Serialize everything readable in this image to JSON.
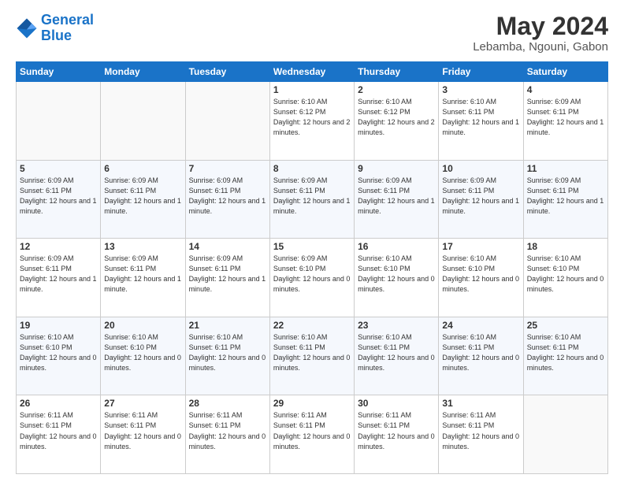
{
  "logo": {
    "line1": "General",
    "line2": "Blue"
  },
  "title": "May 2024",
  "location": "Lebamba, Ngouni, Gabon",
  "days_of_week": [
    "Sunday",
    "Monday",
    "Tuesday",
    "Wednesday",
    "Thursday",
    "Friday",
    "Saturday"
  ],
  "weeks": [
    [
      {
        "day": "",
        "info": ""
      },
      {
        "day": "",
        "info": ""
      },
      {
        "day": "",
        "info": ""
      },
      {
        "day": "1",
        "info": "Sunrise: 6:10 AM\nSunset: 6:12 PM\nDaylight: 12 hours\nand 2 minutes."
      },
      {
        "day": "2",
        "info": "Sunrise: 6:10 AM\nSunset: 6:12 PM\nDaylight: 12 hours\nand 2 minutes."
      },
      {
        "day": "3",
        "info": "Sunrise: 6:10 AM\nSunset: 6:11 PM\nDaylight: 12 hours\nand 1 minute."
      },
      {
        "day": "4",
        "info": "Sunrise: 6:09 AM\nSunset: 6:11 PM\nDaylight: 12 hours\nand 1 minute."
      }
    ],
    [
      {
        "day": "5",
        "info": "Sunrise: 6:09 AM\nSunset: 6:11 PM\nDaylight: 12 hours\nand 1 minute."
      },
      {
        "day": "6",
        "info": "Sunrise: 6:09 AM\nSunset: 6:11 PM\nDaylight: 12 hours\nand 1 minute."
      },
      {
        "day": "7",
        "info": "Sunrise: 6:09 AM\nSunset: 6:11 PM\nDaylight: 12 hours\nand 1 minute."
      },
      {
        "day": "8",
        "info": "Sunrise: 6:09 AM\nSunset: 6:11 PM\nDaylight: 12 hours\nand 1 minute."
      },
      {
        "day": "9",
        "info": "Sunrise: 6:09 AM\nSunset: 6:11 PM\nDaylight: 12 hours\nand 1 minute."
      },
      {
        "day": "10",
        "info": "Sunrise: 6:09 AM\nSunset: 6:11 PM\nDaylight: 12 hours\nand 1 minute."
      },
      {
        "day": "11",
        "info": "Sunrise: 6:09 AM\nSunset: 6:11 PM\nDaylight: 12 hours\nand 1 minute."
      }
    ],
    [
      {
        "day": "12",
        "info": "Sunrise: 6:09 AM\nSunset: 6:11 PM\nDaylight: 12 hours\nand 1 minute."
      },
      {
        "day": "13",
        "info": "Sunrise: 6:09 AM\nSunset: 6:11 PM\nDaylight: 12 hours\nand 1 minute."
      },
      {
        "day": "14",
        "info": "Sunrise: 6:09 AM\nSunset: 6:11 PM\nDaylight: 12 hours\nand 1 minute."
      },
      {
        "day": "15",
        "info": "Sunrise: 6:09 AM\nSunset: 6:10 PM\nDaylight: 12 hours\nand 0 minutes."
      },
      {
        "day": "16",
        "info": "Sunrise: 6:10 AM\nSunset: 6:10 PM\nDaylight: 12 hours\nand 0 minutes."
      },
      {
        "day": "17",
        "info": "Sunrise: 6:10 AM\nSunset: 6:10 PM\nDaylight: 12 hours\nand 0 minutes."
      },
      {
        "day": "18",
        "info": "Sunrise: 6:10 AM\nSunset: 6:10 PM\nDaylight: 12 hours\nand 0 minutes."
      }
    ],
    [
      {
        "day": "19",
        "info": "Sunrise: 6:10 AM\nSunset: 6:10 PM\nDaylight: 12 hours\nand 0 minutes."
      },
      {
        "day": "20",
        "info": "Sunrise: 6:10 AM\nSunset: 6:10 PM\nDaylight: 12 hours\nand 0 minutes."
      },
      {
        "day": "21",
        "info": "Sunrise: 6:10 AM\nSunset: 6:11 PM\nDaylight: 12 hours\nand 0 minutes."
      },
      {
        "day": "22",
        "info": "Sunrise: 6:10 AM\nSunset: 6:11 PM\nDaylight: 12 hours\nand 0 minutes."
      },
      {
        "day": "23",
        "info": "Sunrise: 6:10 AM\nSunset: 6:11 PM\nDaylight: 12 hours\nand 0 minutes."
      },
      {
        "day": "24",
        "info": "Sunrise: 6:10 AM\nSunset: 6:11 PM\nDaylight: 12 hours\nand 0 minutes."
      },
      {
        "day": "25",
        "info": "Sunrise: 6:10 AM\nSunset: 6:11 PM\nDaylight: 12 hours\nand 0 minutes."
      }
    ],
    [
      {
        "day": "26",
        "info": "Sunrise: 6:11 AM\nSunset: 6:11 PM\nDaylight: 12 hours\nand 0 minutes."
      },
      {
        "day": "27",
        "info": "Sunrise: 6:11 AM\nSunset: 6:11 PM\nDaylight: 12 hours\nand 0 minutes."
      },
      {
        "day": "28",
        "info": "Sunrise: 6:11 AM\nSunset: 6:11 PM\nDaylight: 12 hours\nand 0 minutes."
      },
      {
        "day": "29",
        "info": "Sunrise: 6:11 AM\nSunset: 6:11 PM\nDaylight: 12 hours\nand 0 minutes."
      },
      {
        "day": "30",
        "info": "Sunrise: 6:11 AM\nSunset: 6:11 PM\nDaylight: 12 hours\nand 0 minutes."
      },
      {
        "day": "31",
        "info": "Sunrise: 6:11 AM\nSunset: 6:11 PM\nDaylight: 12 hours\nand 0 minutes."
      },
      {
        "day": "",
        "info": ""
      }
    ]
  ]
}
